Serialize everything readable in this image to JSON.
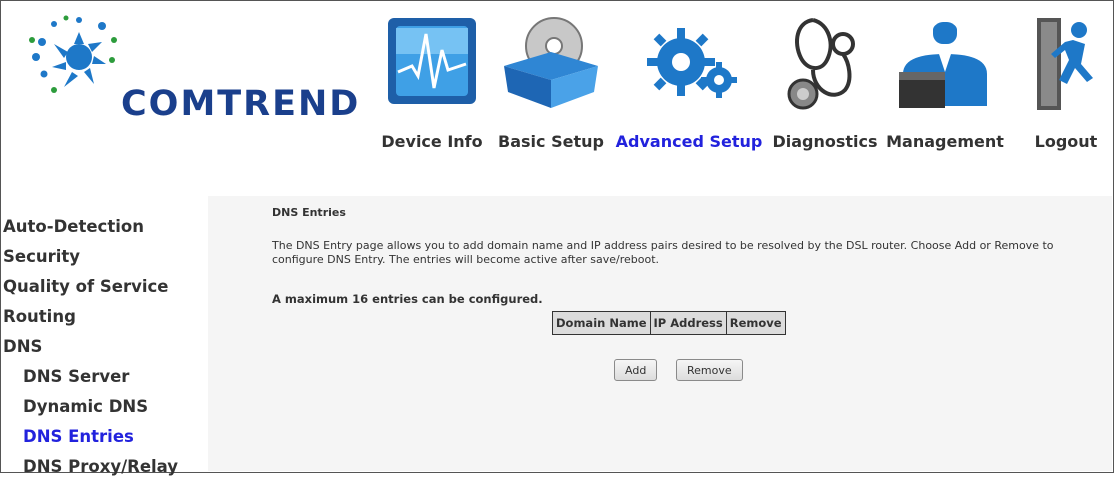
{
  "brand": {
    "name": "COMTREND"
  },
  "nav": [
    {
      "id": "device-info",
      "label": "Device Info",
      "icon": "device-info-monitor-icon",
      "active": false
    },
    {
      "id": "basic-setup",
      "label": "Basic Setup",
      "icon": "basic-setup-disc-box-icon",
      "active": false
    },
    {
      "id": "advanced-setup",
      "label": "Advanced Setup",
      "icon": "advanced-setup-gears-icon",
      "active": true
    },
    {
      "id": "diagnostics",
      "label": "Diagnostics",
      "icon": "diagnostics-stethoscope-icon",
      "active": false
    },
    {
      "id": "management",
      "label": "Management",
      "icon": "management-person-icon",
      "active": false
    },
    {
      "id": "logout",
      "label": "Logout",
      "icon": "logout-running-man-icon",
      "active": false
    }
  ],
  "sidebar": {
    "items": [
      {
        "label": "Auto-Detection",
        "level": "top",
        "active": false
      },
      {
        "label": "Security",
        "level": "top",
        "active": false
      },
      {
        "label": "Quality of Service",
        "level": "top",
        "active": false
      },
      {
        "label": "Routing",
        "level": "top",
        "active": false
      },
      {
        "label": "DNS",
        "level": "top",
        "active": false
      },
      {
        "label": "DNS Server",
        "level": "sub",
        "active": false
      },
      {
        "label": "Dynamic DNS",
        "level": "sub",
        "active": false
      },
      {
        "label": "DNS Entries",
        "level": "sub",
        "active": true
      },
      {
        "label": "DNS Proxy/Relay",
        "level": "sub",
        "active": false
      }
    ]
  },
  "main": {
    "title": "DNS Entries",
    "description": "The DNS Entry page allows you to add domain name and IP address pairs desired to be resolved by the DSL router. Choose Add or Remove to configure DNS Entry. The entries will become active after save/reboot.",
    "max_note": "A maximum 16 entries can be configured.",
    "table": {
      "headers": [
        "Domain Name",
        "IP Address",
        "Remove"
      ]
    },
    "buttons": {
      "add": "Add",
      "remove": "Remove"
    }
  },
  "colors": {
    "active_link": "#2222dd",
    "text": "#333333",
    "content_bg": "#f5f5f5",
    "brand_blue": "#1a3f8c",
    "icon_blue": "#1e78c8"
  }
}
